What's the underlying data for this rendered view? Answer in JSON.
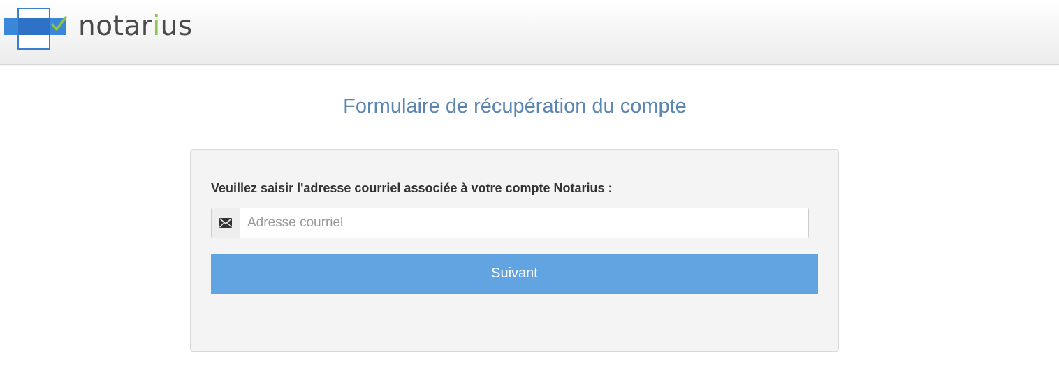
{
  "brand": {
    "name_prefix": "notar",
    "name_accent": "i",
    "name_suffix": "us",
    "accent_color": "#8bc34a",
    "mark_color": "#3a7fd0",
    "icon": "notarius-logo-icon"
  },
  "page": {
    "title": "Formulaire de récupération du compte"
  },
  "form": {
    "prompt": "Veuillez saisir l'adresse courriel associée à votre compte Notarius :",
    "email": {
      "placeholder": "Adresse courriel",
      "value": "",
      "icon": "envelope-icon"
    },
    "submit_label": "Suivant",
    "submit_color": "#62a4e1"
  }
}
